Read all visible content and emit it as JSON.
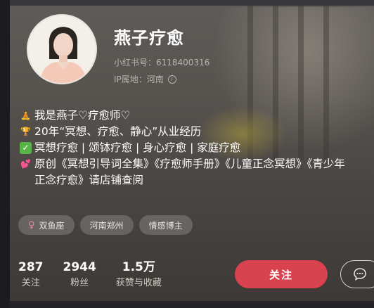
{
  "profile": {
    "nickname": "燕子疗愈",
    "id_label": "小红书号：6118400316",
    "ip_label": "IP属地：河南",
    "info_glyph": "i"
  },
  "bio": {
    "lines": [
      {
        "icon": "meditation-icon",
        "glyph": "🧘",
        "text": "我是燕子♡疗愈师♡"
      },
      {
        "icon": "trophy-icon",
        "glyph": "🏆",
        "text": "20年“冥想、疗愈、静心”从业经历"
      },
      {
        "icon": "check-mark-icon",
        "glyph": "✓",
        "text": "冥想疗愈 | 颂钵疗愈 | 身心疗愈 | 家庭疗愈"
      },
      {
        "icon": "two-hearts-icon",
        "glyph": "💕",
        "text": "原创《冥想引导词全集》《疗愈师手册》《儿童正念冥想》《青少年正念疗愈》请店铺查阅"
      }
    ]
  },
  "tags": {
    "gender_glyph": "♀",
    "items": [
      "双鱼座",
      "河南郑州",
      "情感博主"
    ]
  },
  "stats": {
    "following": {
      "value": "287",
      "label": "关注"
    },
    "followers": {
      "value": "2944",
      "label": "粉丝"
    },
    "likes": {
      "value": "1.5万",
      "label": "获赞与收藏"
    }
  },
  "actions": {
    "follow_label": "关注",
    "chat_icon": "chat-bubble-icon"
  },
  "colors": {
    "follow_button": "#d8424e",
    "text_primary": "#ffffff",
    "text_secondary": "#b9b4ae"
  }
}
